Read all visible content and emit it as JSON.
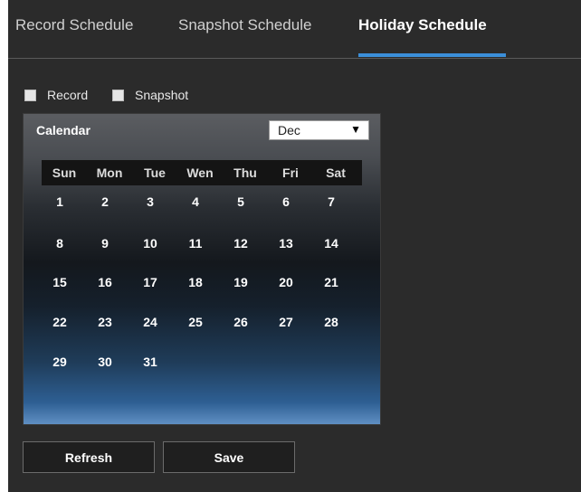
{
  "tabs": [
    {
      "label": "Record Schedule",
      "active": false
    },
    {
      "label": "Snapshot Schedule",
      "active": false
    },
    {
      "label": "Holiday Schedule",
      "active": true
    }
  ],
  "accent_color": "#3b8fd9",
  "checkboxes": [
    {
      "label": "Record",
      "checked": false
    },
    {
      "label": "Snapshot",
      "checked": false
    }
  ],
  "calendar": {
    "title": "Calendar",
    "month": {
      "selected": "Dec",
      "arrow_icon": "dropdown-arrow-icon",
      "arrow_glyph": "▼"
    },
    "weekdays": [
      "Sun",
      "Mon",
      "Tue",
      "Wen",
      "Thu",
      "Fri",
      "Sat"
    ],
    "weeks": [
      [
        "1",
        "2",
        "3",
        "4",
        "5",
        "6",
        "7"
      ],
      [
        "8",
        "9",
        "10",
        "11",
        "12",
        "13",
        "14"
      ],
      [
        "15",
        "16",
        "17",
        "18",
        "19",
        "20",
        "21"
      ],
      [
        "22",
        "23",
        "24",
        "25",
        "26",
        "27",
        "28"
      ],
      [
        "29",
        "30",
        "31"
      ]
    ]
  },
  "buttons": {
    "refresh": "Refresh",
    "save": "Save"
  }
}
